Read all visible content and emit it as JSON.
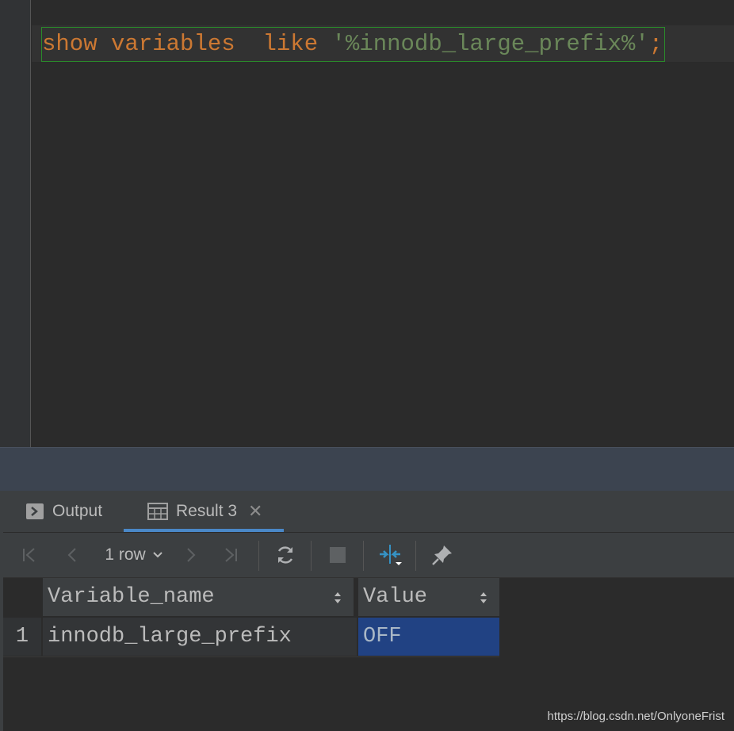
{
  "editor": {
    "code": {
      "keyword1": "show",
      "keyword2": "variables",
      "keyword3": "like",
      "string": "'%innodb_large_prefix%'",
      "terminator": ";"
    }
  },
  "tool_window": {
    "tabs": [
      {
        "label": "Output",
        "icon": "console-icon"
      },
      {
        "label": "Result 3",
        "icon": "table-icon",
        "active": true
      }
    ],
    "toolbar": {
      "row_count": "1 row",
      "icons": [
        "first-page-icon",
        "previous-page-icon",
        "next-page-icon",
        "last-page-icon",
        "refresh-icon",
        "stop-icon",
        "compare-icon",
        "pin-icon"
      ]
    },
    "grid": {
      "columns": [
        "Variable_name",
        "Value"
      ],
      "rows": [
        {
          "num": "1",
          "cells": [
            "innodb_large_prefix",
            "OFF"
          ]
        }
      ]
    }
  },
  "watermark": "https://blog.csdn.net/OnlyoneFrist",
  "colors": {
    "keyword": "#cc7832",
    "string": "#6a8759",
    "selection": "#214283",
    "active_tab": "#4a88c7"
  }
}
